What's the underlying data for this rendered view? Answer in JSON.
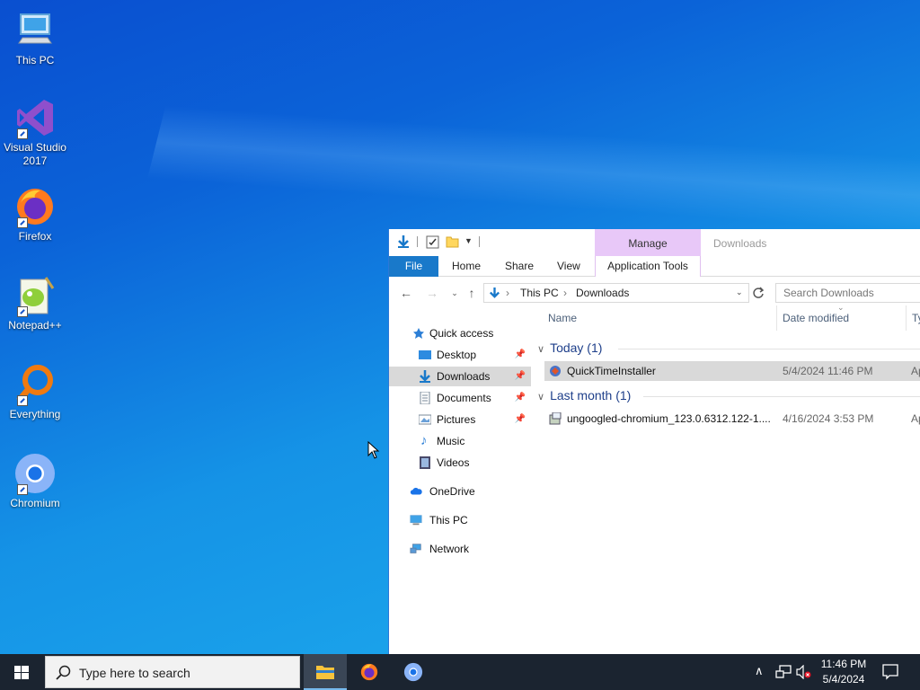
{
  "desktop": {
    "icons": [
      {
        "label": "This PC",
        "icon": "monitor-icon"
      },
      {
        "label": "Visual Studio 2017",
        "icon": "visual-studio-icon"
      },
      {
        "label": "Firefox",
        "icon": "firefox-icon"
      },
      {
        "label": "Notepad++",
        "icon": "notepadpp-icon"
      },
      {
        "label": "Everything",
        "icon": "everything-search-icon"
      },
      {
        "label": "Chromium",
        "icon": "chromium-icon"
      }
    ]
  },
  "explorer": {
    "ribbon": {
      "manage": "Manage",
      "window_title": "Downloads",
      "tabs": {
        "file": "File",
        "home": "Home",
        "share": "Share",
        "view": "View",
        "app_tools": "Application Tools"
      }
    },
    "address": {
      "seg1": "This PC",
      "seg2": "Downloads"
    },
    "search_placeholder": "Search Downloads",
    "nav": {
      "quick_access": "Quick access",
      "desktop": "Desktop",
      "downloads": "Downloads",
      "documents": "Documents",
      "pictures": "Pictures",
      "music": "Music",
      "videos": "Videos",
      "onedrive": "OneDrive",
      "this_pc": "This PC",
      "network": "Network"
    },
    "columns": {
      "name": "Name",
      "date": "Date modified",
      "type": "Ty"
    },
    "groups": [
      {
        "label": "Today (1)"
      },
      {
        "label": "Last month (1)"
      }
    ],
    "files": [
      {
        "name": "QuickTimeInstaller",
        "date": "5/4/2024 11:46 PM",
        "type": "Ap"
      },
      {
        "name": "ungoogled-chromium_123.0.6312.122-1....",
        "date": "4/16/2024 3:53 PM",
        "type": "Ap"
      }
    ]
  },
  "taskbar": {
    "search_placeholder": "Type here to search",
    "time": "11:46 PM",
    "date": "5/4/2024"
  }
}
